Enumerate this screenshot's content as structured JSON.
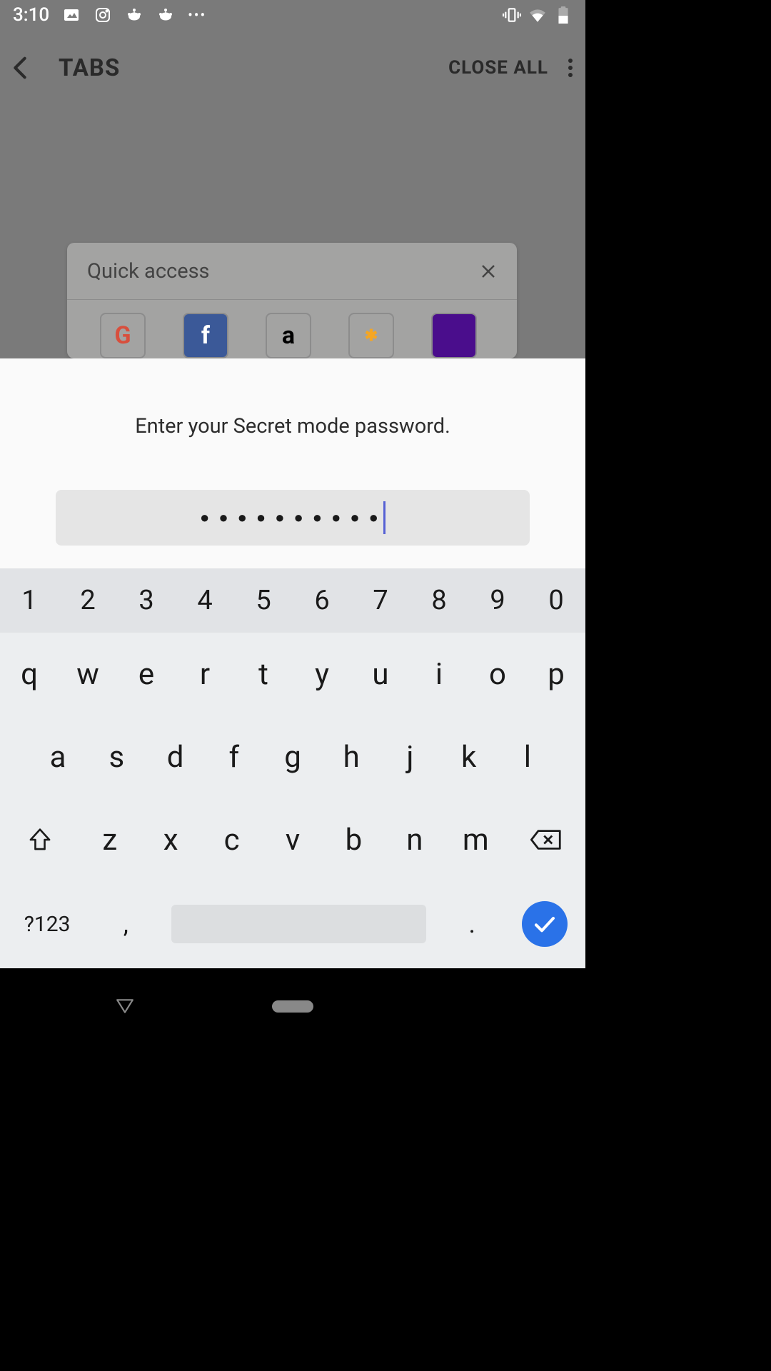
{
  "status": {
    "time": "3:10"
  },
  "appbar": {
    "title": "TABS",
    "close_all": "CLOSE ALL"
  },
  "quick_access": {
    "title": "Quick access",
    "sites": [
      "G",
      "f",
      "a",
      "✱",
      ""
    ]
  },
  "prompt": {
    "text": "Enter your Secret mode password.",
    "value": "●●●●●●●●●●"
  },
  "keyboard": {
    "row_numbers": [
      "1",
      "2",
      "3",
      "4",
      "5",
      "6",
      "7",
      "8",
      "9",
      "0"
    ],
    "row1": [
      "q",
      "w",
      "e",
      "r",
      "t",
      "y",
      "u",
      "i",
      "o",
      "p"
    ],
    "row2": [
      "a",
      "s",
      "d",
      "f",
      "g",
      "h",
      "j",
      "k",
      "l"
    ],
    "row3": [
      "z",
      "x",
      "c",
      "v",
      "b",
      "n",
      "m"
    ],
    "symbol": "?123",
    "comma": ",",
    "period": "."
  }
}
